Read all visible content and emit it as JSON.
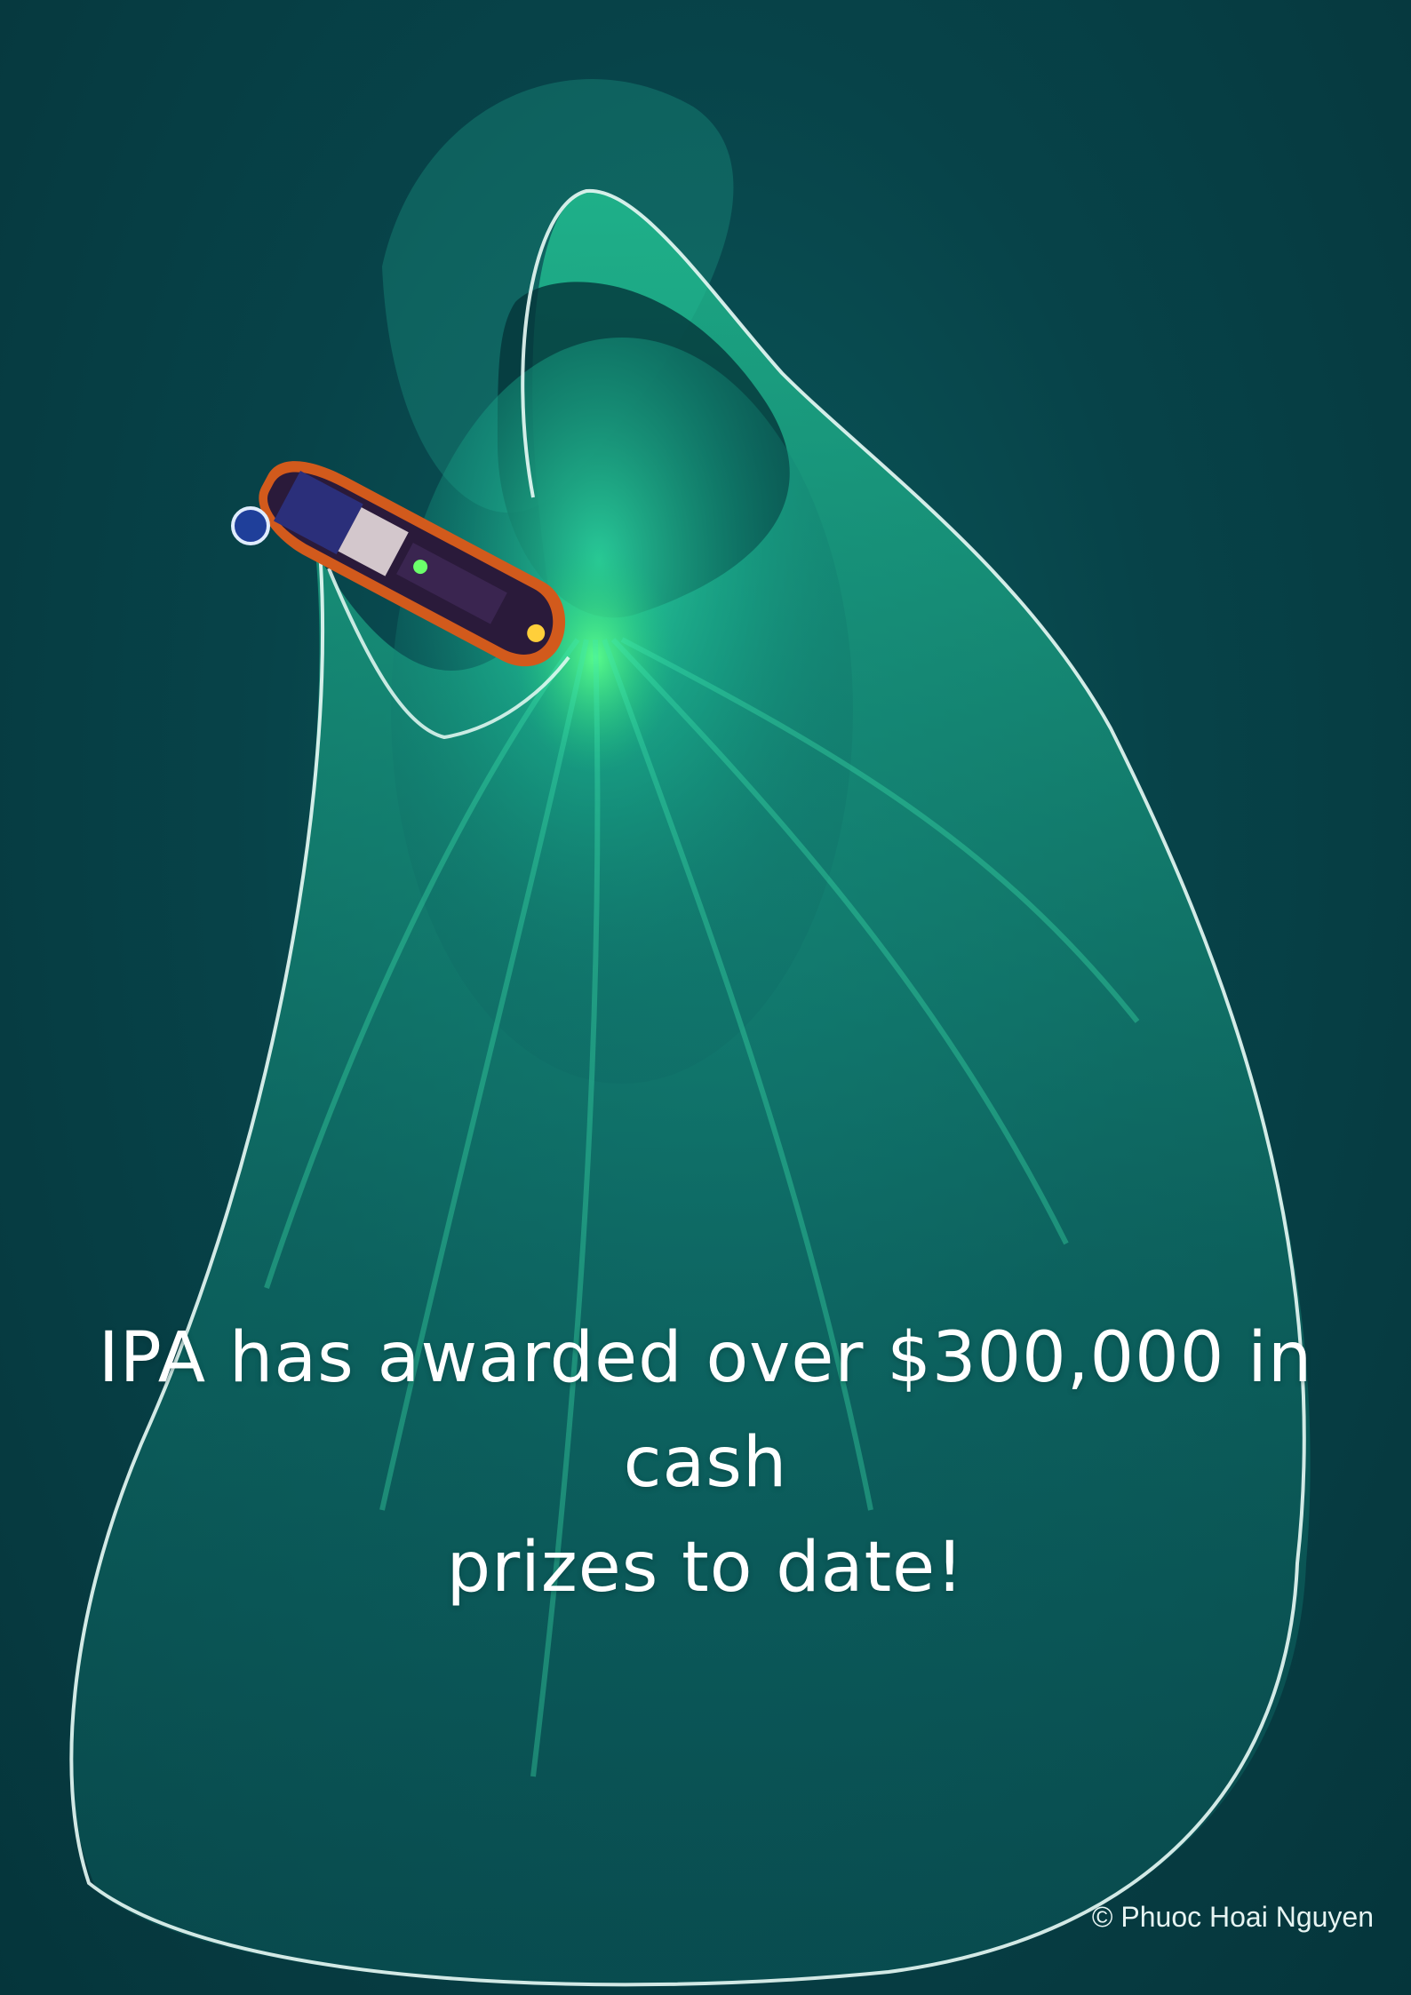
{
  "poster": {
    "headline_line1": "IPA has awarded over $300,000 in cash",
    "headline_line2": "prizes to date!",
    "credit": "© Phuoc Hoai Nguyen"
  },
  "colors": {
    "sea": "#074349",
    "net": "#2fd6a0",
    "float_line": "#e9fbf6",
    "text": "#ffffff"
  }
}
